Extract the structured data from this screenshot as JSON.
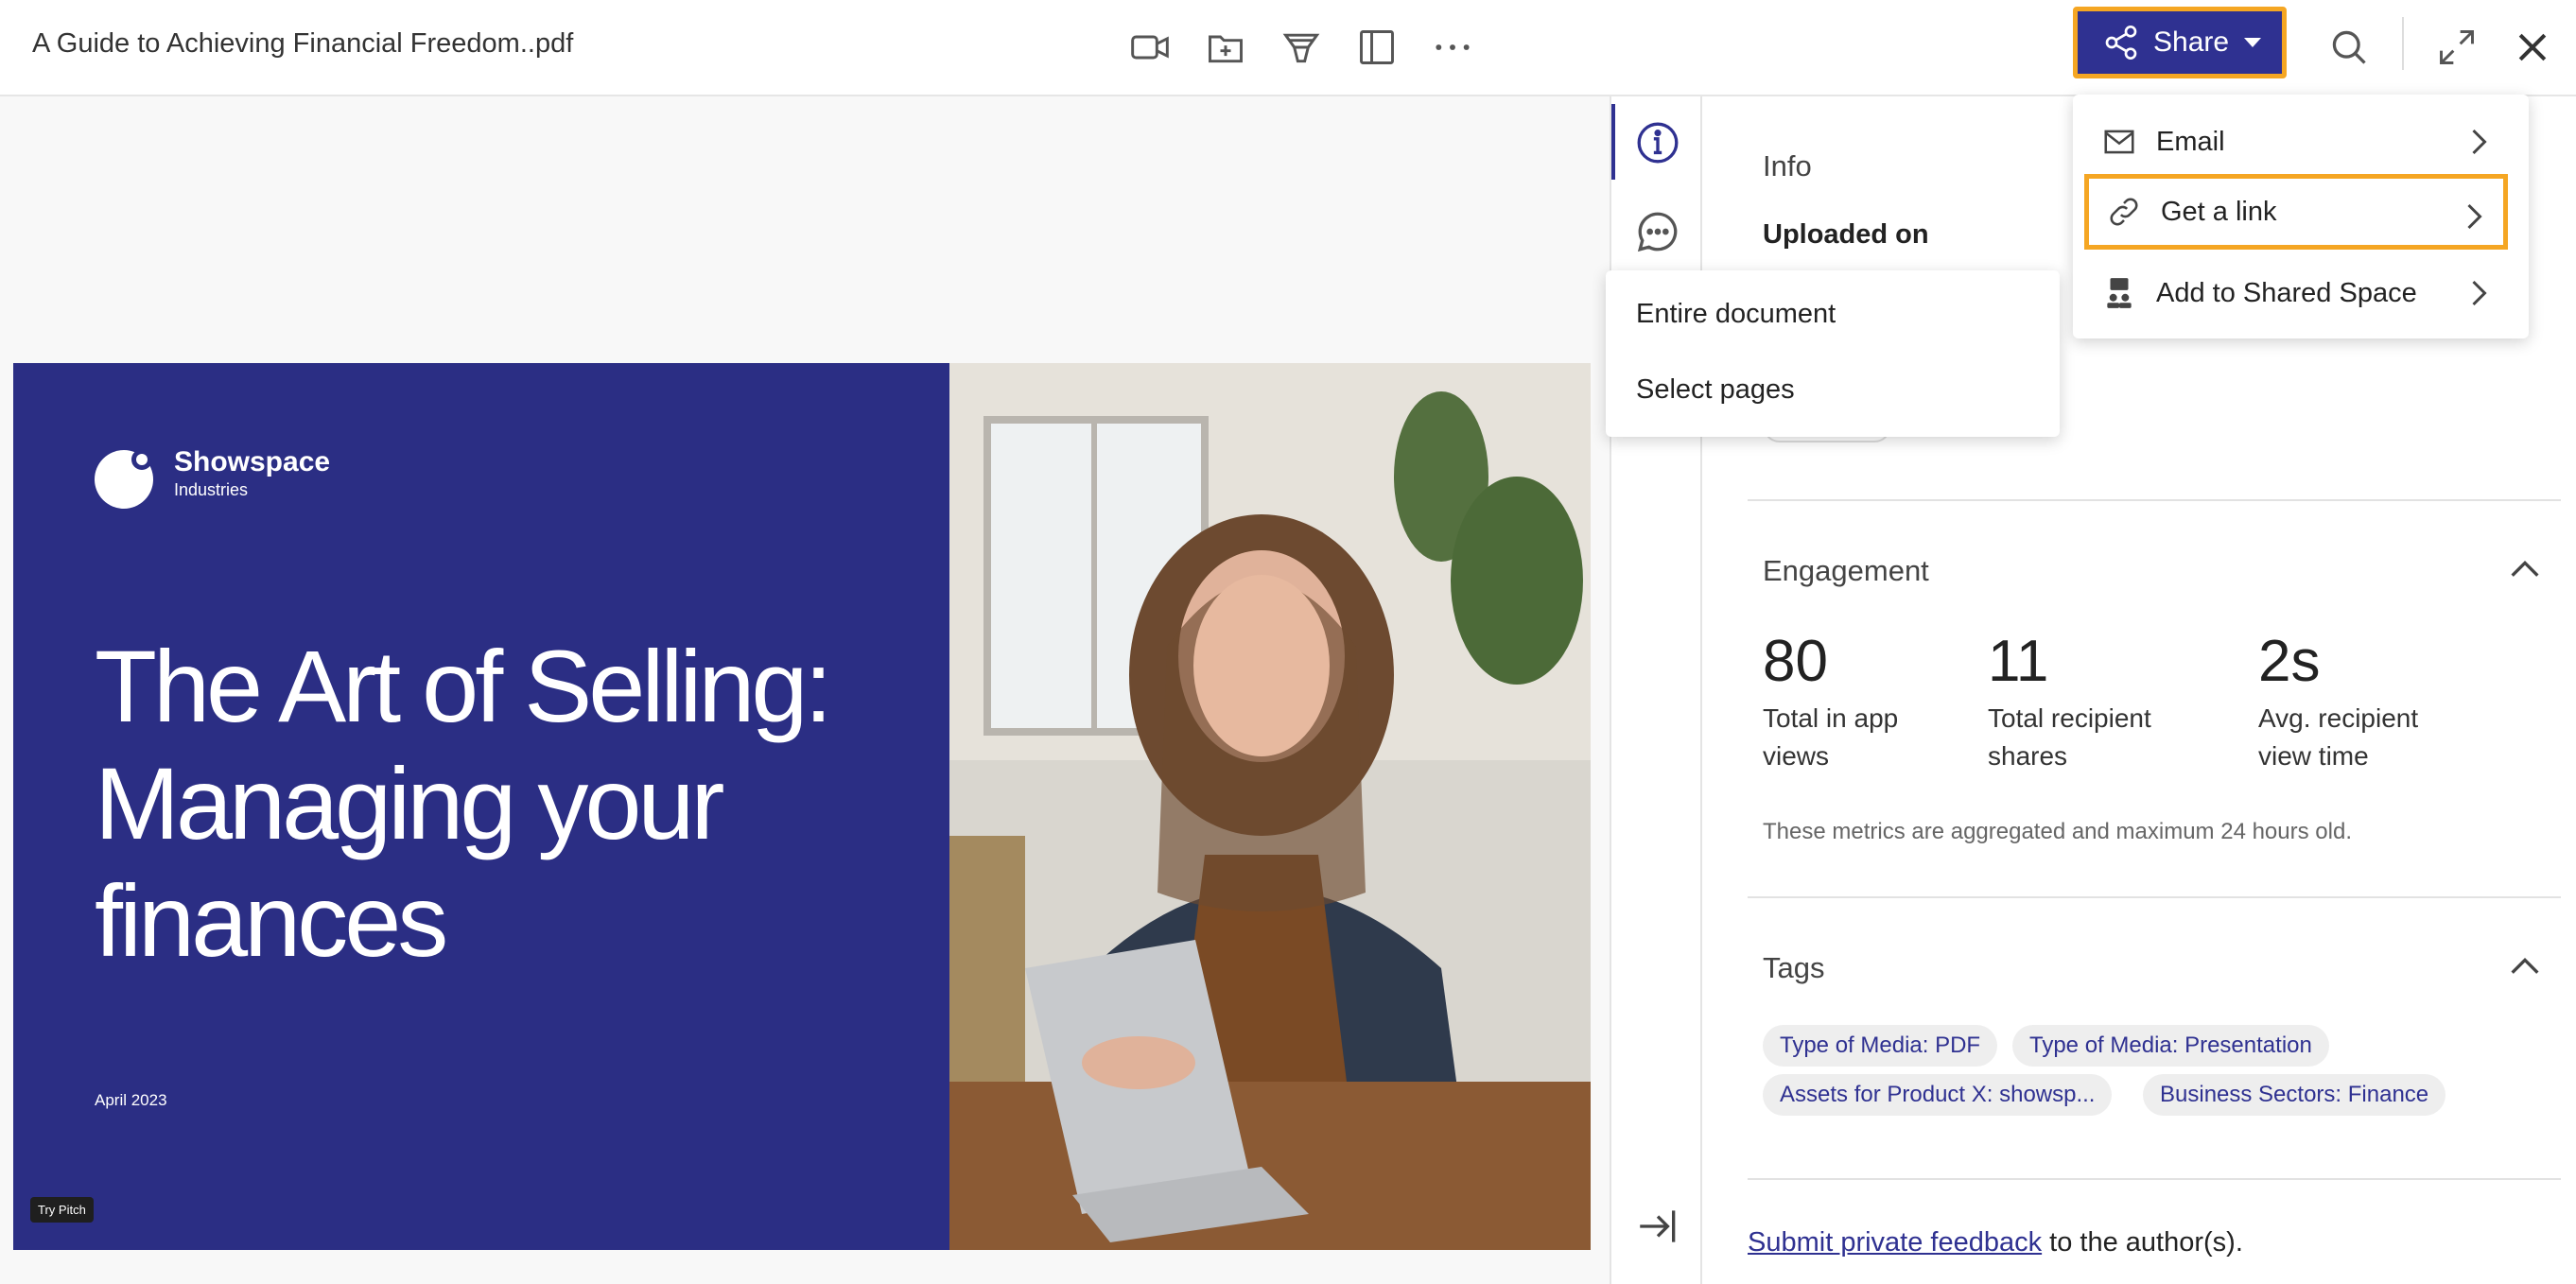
{
  "header": {
    "doc_title": "A Guide to Achieving Financial Freedom..pdf",
    "tools": [
      "video-icon",
      "add-to-folder-icon",
      "funnel-icon",
      "panel-layout-icon",
      "more-icon"
    ],
    "share_label": "Share",
    "right_icons": [
      "search-icon",
      "expand-icon",
      "close-icon"
    ]
  },
  "share_menu": {
    "items": [
      {
        "label": "Email",
        "icon": "mail-icon"
      },
      {
        "label": "Get a link",
        "icon": "link-icon"
      },
      {
        "label": "Add to Shared Space",
        "icon": "shared-space-icon"
      }
    ]
  },
  "sub_menu": {
    "items": [
      "Entire document",
      "Select pages"
    ]
  },
  "slide": {
    "brand_name": "Showspace",
    "brand_sub": "Industries",
    "heading": "The Art of Selling: Managing your finances",
    "date": "April 2023",
    "badge": "Try Pitch"
  },
  "panel": {
    "info_title": "Info",
    "uploaded_label": "Uploaded on",
    "engagement_title": "Engagement",
    "stats": [
      {
        "value": "80",
        "label": "Total in app views"
      },
      {
        "value": "11",
        "label": "Total recipient shares"
      },
      {
        "value": "2s",
        "label": "Avg. recipient view time"
      }
    ],
    "metrics_note": "These metrics are aggregated and maximum 24 hours old.",
    "tags_title": "Tags",
    "tags": [
      "Type of Media: PDF",
      "Type of Media: Presentation",
      "Assets for Product X: showsp...",
      "Business Sectors: Finance"
    ],
    "feedback_link": "Submit private feedback",
    "feedback_rest": " to the author(s)."
  },
  "colors": {
    "accent": "#2f3191",
    "highlight": "#f5a623",
    "slide_bg": "#2b2e84"
  }
}
